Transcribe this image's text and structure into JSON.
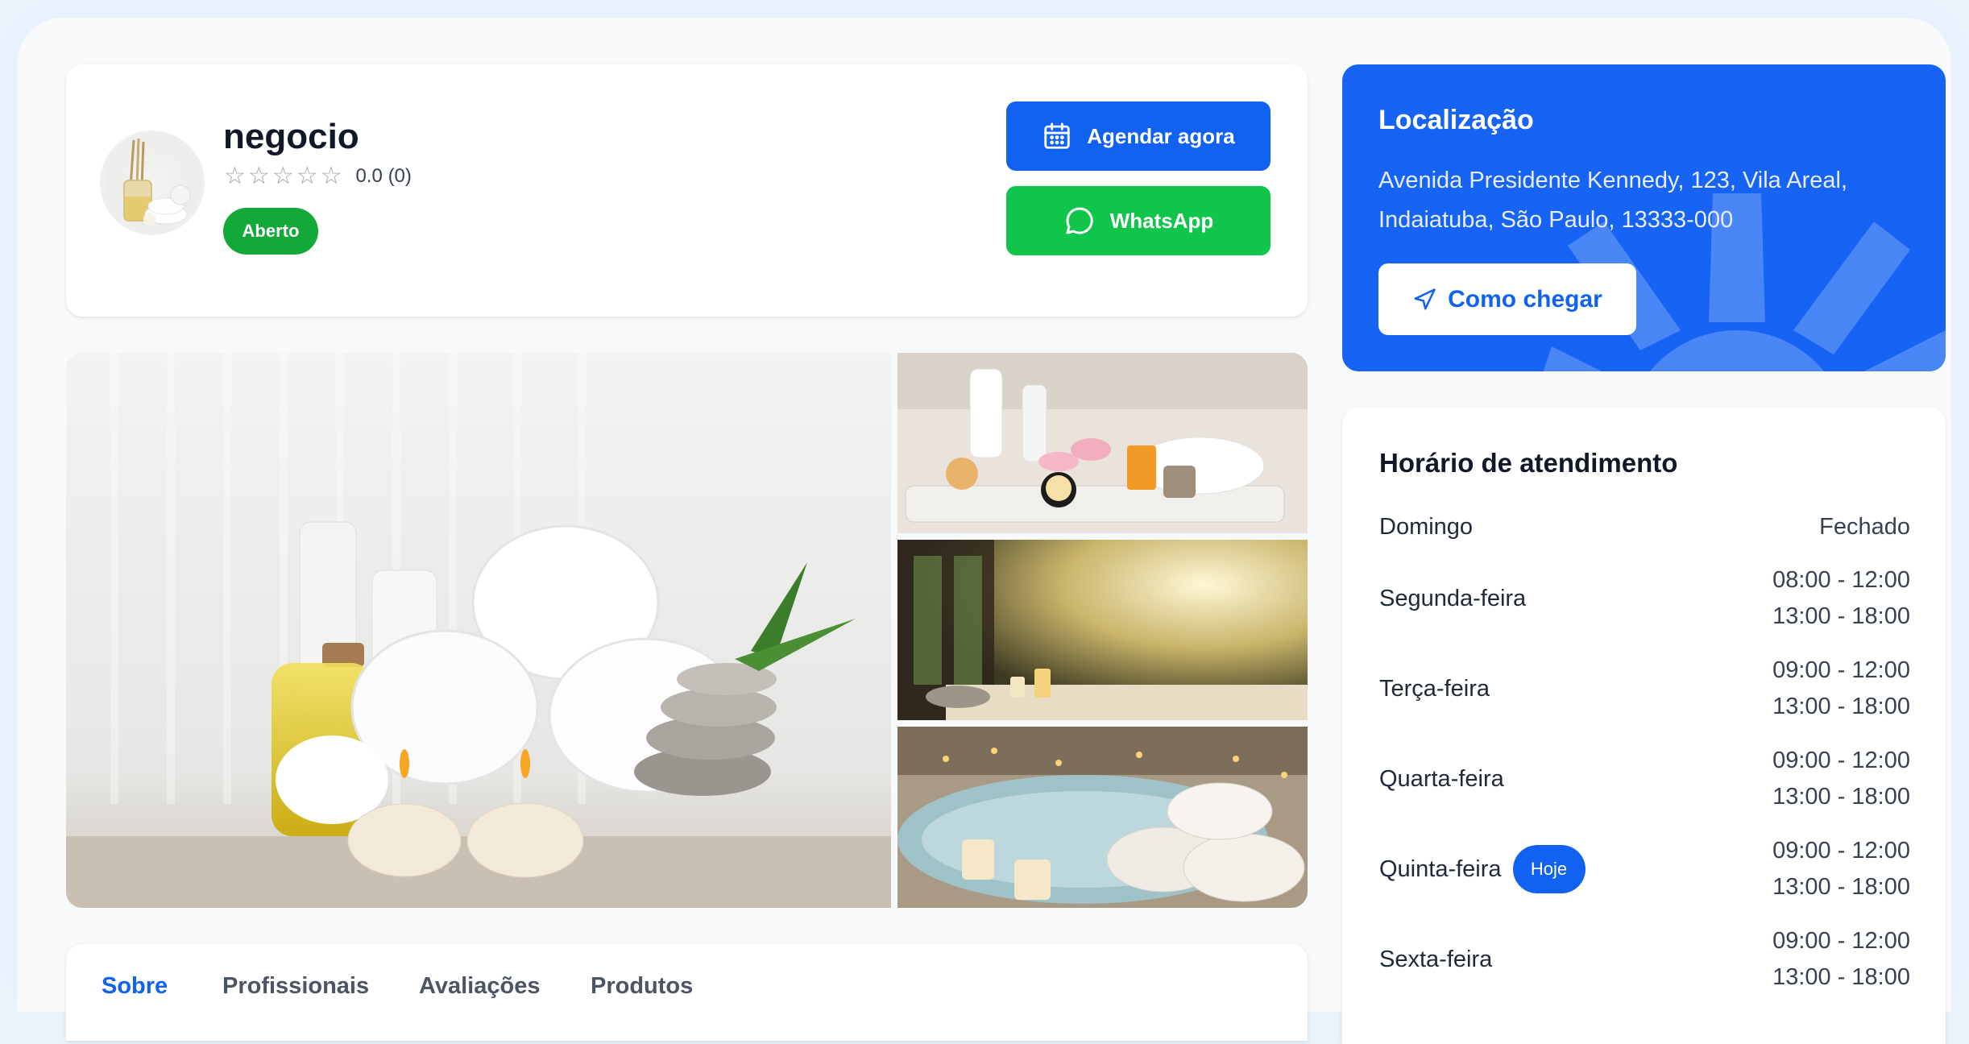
{
  "business": {
    "name": "negocio",
    "rating_text": "0.0 (0)",
    "rating": 0,
    "rating_max": 5,
    "status": "Aberto"
  },
  "actions": {
    "book_label": "Agendar agora",
    "whatsapp_label": "WhatsApp"
  },
  "location": {
    "title": "Localização",
    "address": "Avenida Presidente Kennedy, 123, Vila Areal, Indaiatuba, São Paulo, 13333-000",
    "route_label": "Como chegar"
  },
  "hours": {
    "title": "Horário de atendimento",
    "today_label": "Hoje",
    "days": [
      {
        "day": "Domingo",
        "times": [
          "Fechado"
        ],
        "today": false
      },
      {
        "day": "Segunda-feira",
        "times": [
          "08:00 - 12:00",
          "13:00 - 18:00"
        ],
        "today": false
      },
      {
        "day": "Terça-feira",
        "times": [
          "09:00 - 12:00",
          "13:00 - 18:00"
        ],
        "today": false
      },
      {
        "day": "Quarta-feira",
        "times": [
          "09:00 - 12:00",
          "13:00 - 18:00"
        ],
        "today": false
      },
      {
        "day": "Quinta-feira",
        "times": [
          "09:00 - 12:00",
          "13:00 - 18:00"
        ],
        "today": true
      },
      {
        "day": "Sexta-feira",
        "times": [
          "09:00 - 12:00",
          "13:00 - 18:00"
        ],
        "today": false
      }
    ]
  },
  "tabs": [
    {
      "label": "Sobre",
      "active": true
    },
    {
      "label": "Profissionais",
      "active": false
    },
    {
      "label": "Avaliações",
      "active": false
    },
    {
      "label": "Produtos",
      "active": false
    }
  ],
  "colors": {
    "primary": "#1262f2",
    "whatsapp": "#0fc54b",
    "open_badge": "#12a83a",
    "location_bg": "#1763f3"
  }
}
